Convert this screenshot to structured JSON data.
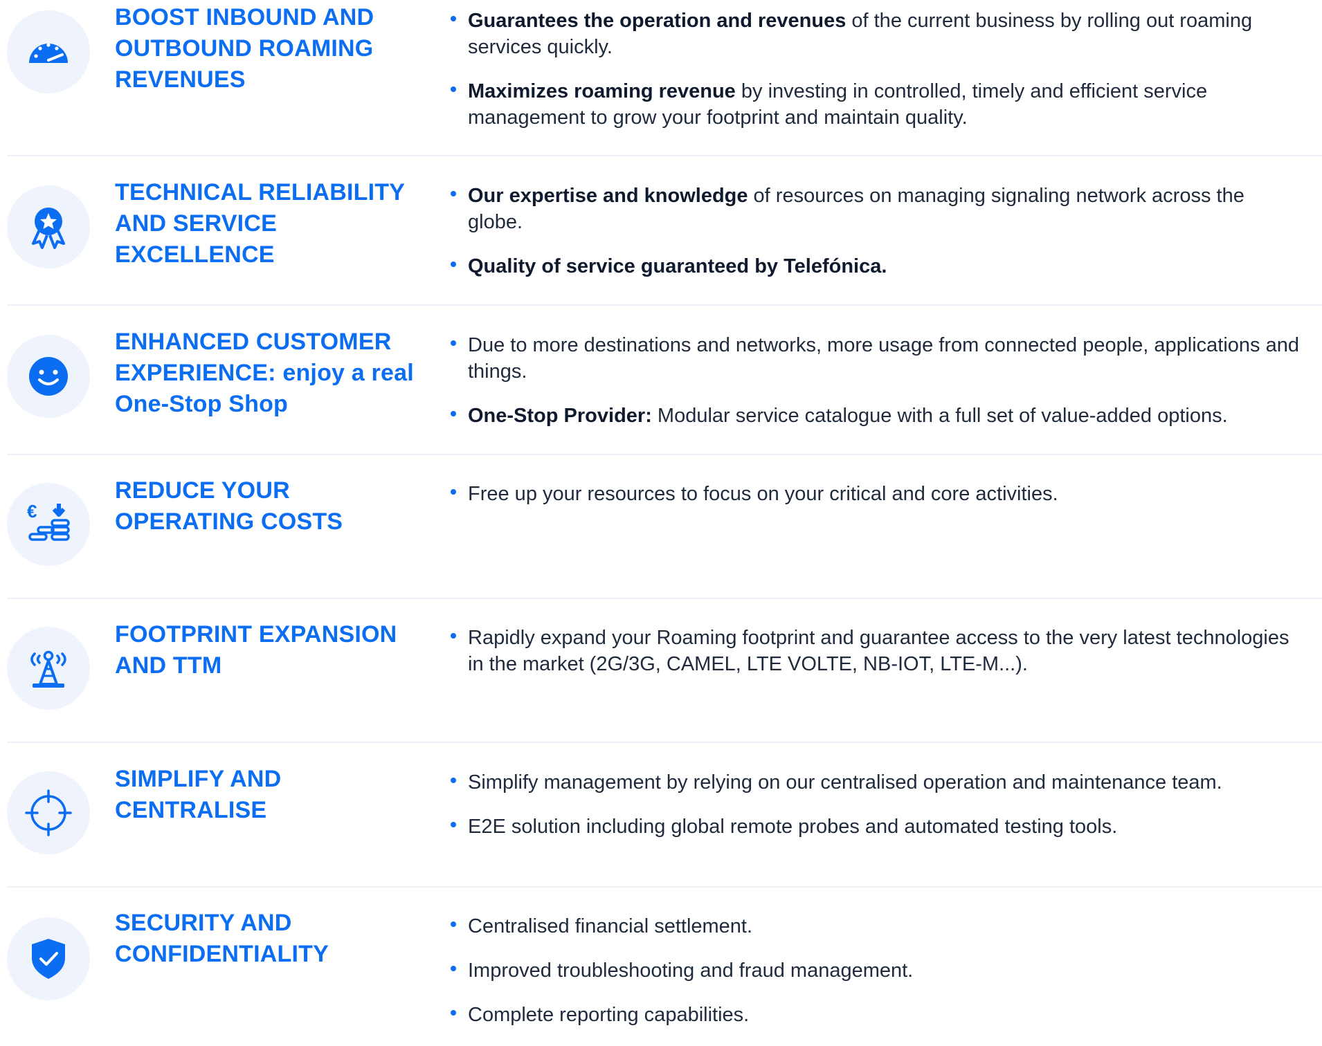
{
  "colors": {
    "accent": "#0b6df1",
    "icon_bg": "#eef3fc",
    "text": "#1f2a3c",
    "divider": "#eef2f8"
  },
  "rows": [
    {
      "icon": "speedometer-icon",
      "title": "BOOST INBOUND AND OUTBOUND ROAMING REVENUES",
      "points": [
        {
          "bold": "Guarantees the operation and revenues",
          "text": " of the current business by rolling out roaming services quickly."
        },
        {
          "bold": "Maximizes roaming revenue",
          "text": " by investing in controlled, timely and efficient service management to grow your footprint and maintain quality."
        }
      ]
    },
    {
      "icon": "award-badge-icon",
      "title": "TECHNICAL RELIABILITY AND SERVICE EXCELLENCE",
      "points": [
        {
          "bold": "Our expertise and knowledge",
          "text": " of resources on managing signaling network across the globe."
        },
        {
          "bold": "Quality of service guaranteed by Telefónica.",
          "text": ""
        }
      ]
    },
    {
      "icon": "smiley-face-icon",
      "title": "ENHANCED CUSTOMER EXPERIENCE: enjoy a real One-Stop Shop",
      "points": [
        {
          "bold": "",
          "text": "Due to more destinations and networks, more usage from connected people, applications and things."
        },
        {
          "bold": "One-Stop Provider:",
          "text": " Modular service catalogue with a full set of value-added options."
        }
      ]
    },
    {
      "icon": "euro-coins-down-icon",
      "title": "REDUCE YOUR OPERATING COSTS",
      "points": [
        {
          "bold": "",
          "text": " Free up your resources to focus on your critical and core activities."
        }
      ]
    },
    {
      "icon": "antenna-tower-icon",
      "title": "FOOTPRINT EXPANSION AND TTM",
      "points": [
        {
          "bold": "",
          "text": "Rapidly expand your Roaming footprint and guarantee access to the very latest technologies in the market (2G/3G, CAMEL, LTE VOLTE, NB-IOT, LTE-M...)."
        }
      ]
    },
    {
      "icon": "crosshair-target-icon",
      "title": "SIMPLIFY AND CENTRALISE",
      "points": [
        {
          "bold": "",
          "text": "Simplify management by relying on our centralised operation and maintenance team."
        },
        {
          "bold": "",
          "text": "E2E solution including global remote probes and automated testing tools."
        }
      ]
    },
    {
      "icon": "shield-check-icon",
      "title": "SECURITY AND CONFIDENTIALITY",
      "points": [
        {
          "bold": "",
          "text": "Centralised financial settlement."
        },
        {
          "bold": "",
          "text": "Improved troubleshooting and fraud management."
        },
        {
          "bold": "",
          "text": "Complete reporting capabilities."
        }
      ]
    }
  ]
}
